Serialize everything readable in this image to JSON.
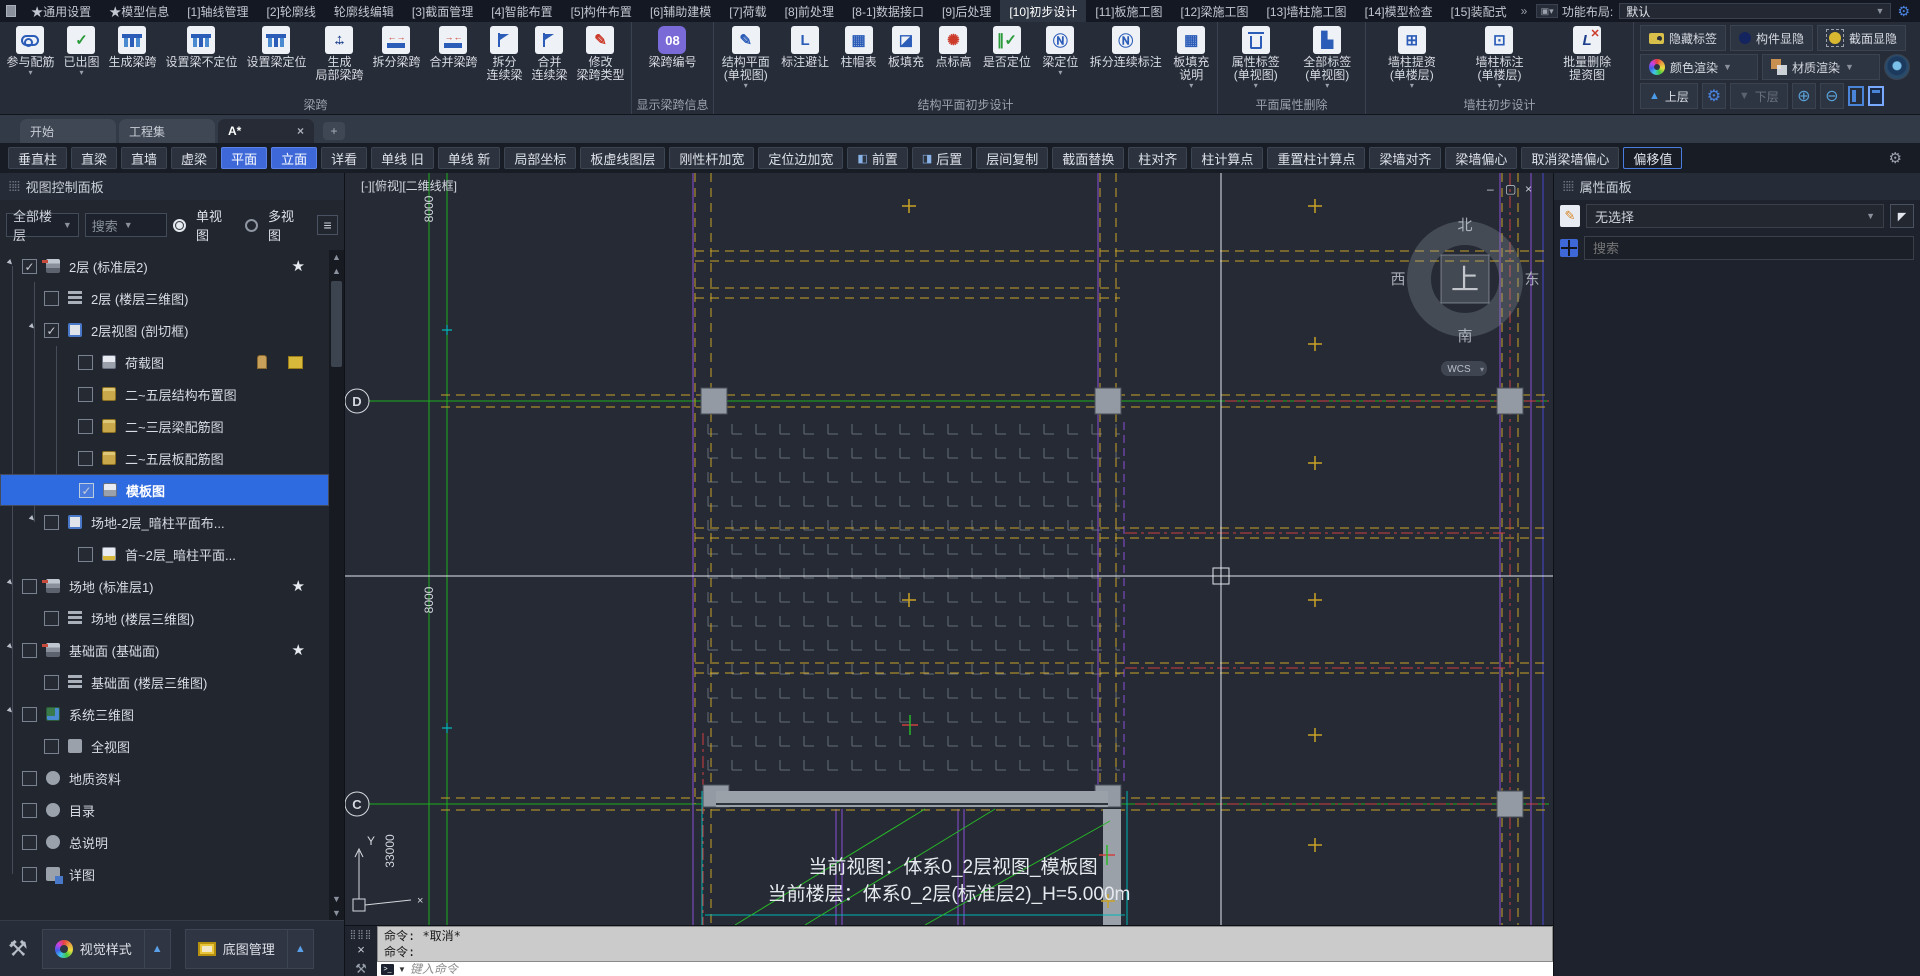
{
  "menu": {
    "items": [
      "★通用设置",
      "★模型信息",
      "[1]轴线管理",
      "[2]轮廓线",
      "轮廓线编辑",
      "[3]截面管理",
      "[4]智能布置",
      "[5]构件布置",
      "[6]辅助建模",
      "[7]荷载",
      "[8]前处理",
      "[8-1]数据接口",
      "[9]后处理",
      "[10]初步设计",
      "[11]板施工图",
      "[12]梁施工图",
      "[13]墙柱施工图",
      "[14]模型检查",
      "[15]装配式"
    ],
    "active_item": "[10]初步设计",
    "layout_label": "功能布局:",
    "layout_value": "默认"
  },
  "ribbon": {
    "groups": [
      {
        "label": "梁跨",
        "buttons": [
          {
            "label": "参与配筋",
            "dropdown": true
          },
          {
            "label": "已出图",
            "dropdown": true
          },
          {
            "label": "生成梁跨"
          },
          {
            "label": "设置梁不定位"
          },
          {
            "label": "设置梁定位"
          },
          {
            "label": "生成\n局部梁跨"
          },
          {
            "label": "拆分梁跨"
          },
          {
            "label": "合并梁跨"
          },
          {
            "label": "拆分\n连续梁"
          },
          {
            "label": "合并\n连续梁"
          },
          {
            "label": "修改\n梁跨类型"
          }
        ]
      },
      {
        "label": "显示梁跨信息",
        "buttons": [
          {
            "label": "梁跨编号",
            "badge": "08"
          }
        ]
      },
      {
        "label": "结构平面初步设计",
        "buttons": [
          {
            "label": "结构平面\n(单视图)",
            "dropdown": true
          },
          {
            "label": "标注避让"
          },
          {
            "label": "柱帽表"
          },
          {
            "label": "板填充"
          },
          {
            "label": "点标高"
          },
          {
            "label": "是否定位"
          },
          {
            "label": "梁定位",
            "dropdown": true
          },
          {
            "label": "拆分连续标注"
          },
          {
            "label": "板填充\n说明",
            "dropdown": true
          }
        ]
      },
      {
        "label": "平面属性删除",
        "buttons": [
          {
            "label": "属性标签\n(单视图)",
            "dropdown": true
          },
          {
            "label": "全部标签\n(单视图)",
            "dropdown": true
          }
        ]
      },
      {
        "label": "墙柱初步设计",
        "buttons": [
          {
            "label": "墙柱提资\n(单楼层)",
            "dropdown": true
          },
          {
            "label": "墙柱标注\n(单楼层)",
            "dropdown": true
          },
          {
            "label": "批量删除\n提资图"
          }
        ]
      }
    ],
    "utility": {
      "hide_labels": "隐藏标签",
      "component_vis": "构件显隐",
      "section_vis": "截面显隐",
      "color_render": "颜色渲染",
      "material_render": "材质渲染",
      "upper": "上层",
      "lower": "下层"
    }
  },
  "tabs": {
    "items": [
      "开始",
      "工程集",
      "A*"
    ],
    "active": "A*"
  },
  "quickbar": {
    "buttons": [
      "垂直柱",
      "直梁",
      "直墙",
      "虚梁",
      "平面",
      "立面",
      "详看",
      "单线 旧",
      "单线 新",
      "局部坐标",
      "板虚线图层",
      "刚性杆加宽",
      "定位边加宽",
      "前置",
      "后置",
      "层间复制",
      "截面替换",
      "柱对齐",
      "柱计算点",
      "重置柱计算点",
      "梁墙对齐",
      "梁墙偏心",
      "取消梁墙偏心",
      "偏移值"
    ],
    "active_buttons": [
      "平面",
      "立面"
    ],
    "outlined_button": "偏移值"
  },
  "sidebar": {
    "title": "视图控制面板",
    "floor_filter": "全部楼层",
    "search": "搜索",
    "single_view": "单视图",
    "multi_view": "多视图",
    "tree": [
      {
        "label": "2层  (标准层2)",
        "checked": true,
        "star": true
      },
      {
        "label": "2层  (楼层三维图)",
        "checked": false
      },
      {
        "label": "2层视图  (剖切框)",
        "checked": true
      },
      {
        "label": "荷载图",
        "checked": false
      },
      {
        "label": "二~五层结构布置图",
        "checked": false
      },
      {
        "label": "二~三层梁配筋图",
        "checked": false
      },
      {
        "label": "二~五层板配筋图",
        "checked": false
      },
      {
        "label": "模板图",
        "checked": true,
        "selected": true
      },
      {
        "label": "场地-2层_暗柱平面布...",
        "checked": false
      },
      {
        "label": "首~2层_暗柱平面...",
        "checked": false
      },
      {
        "label": "场地  (标准层1)",
        "checked": false,
        "star": true
      },
      {
        "label": "场地  (楼层三维图)",
        "checked": false
      },
      {
        "label": "基础面  (基础面)",
        "checked": false,
        "star": true
      },
      {
        "label": "基础面  (楼层三维图)",
        "checked": false
      },
      {
        "label": "系统三维图",
        "checked": false
      },
      {
        "label": "全视图",
        "checked": false
      },
      {
        "label": "地质资料",
        "checked": false
      },
      {
        "label": "目录",
        "checked": false
      },
      {
        "label": "总说明",
        "checked": false
      },
      {
        "label": "详图",
        "checked": false
      }
    ],
    "visual_style": "视觉样式",
    "base_map": "底图管理"
  },
  "canvas": {
    "viewport_label": "[-][俯视][二维线框]",
    "axis_d": "D",
    "axis_c": "C",
    "dim_top": "8000",
    "dim_mid": "8000",
    "dim_bottom": "33000",
    "compass": {
      "north": "北",
      "south": "南",
      "east": "东",
      "west": "西",
      "center": "上"
    },
    "wcs": "WCS",
    "ucs_y": "Y",
    "status_view": "当前视图：体系0_2层视图_模板图",
    "status_floor": "当前楼层：体系0_2层(标准层2)_H=5.000m"
  },
  "properties": {
    "title": "属性面板",
    "selection": "无选择",
    "search_placeholder": "搜索"
  },
  "command": {
    "history_line1": "命令: *取消*",
    "history_line2": "命令:",
    "input_placeholder": "键入命令"
  },
  "colors": {
    "accent": "#3e68d8",
    "selection": "#2f6be0",
    "ribbon_icon_blue": "#2b5cb8",
    "cad_green": "#1fae1f",
    "cad_yellow": "#c9a227",
    "cad_purple": "#8a4fd8",
    "cad_cyan": "#00b6b6",
    "cad_red": "#d04040",
    "cad_grey": "#939aa3"
  }
}
